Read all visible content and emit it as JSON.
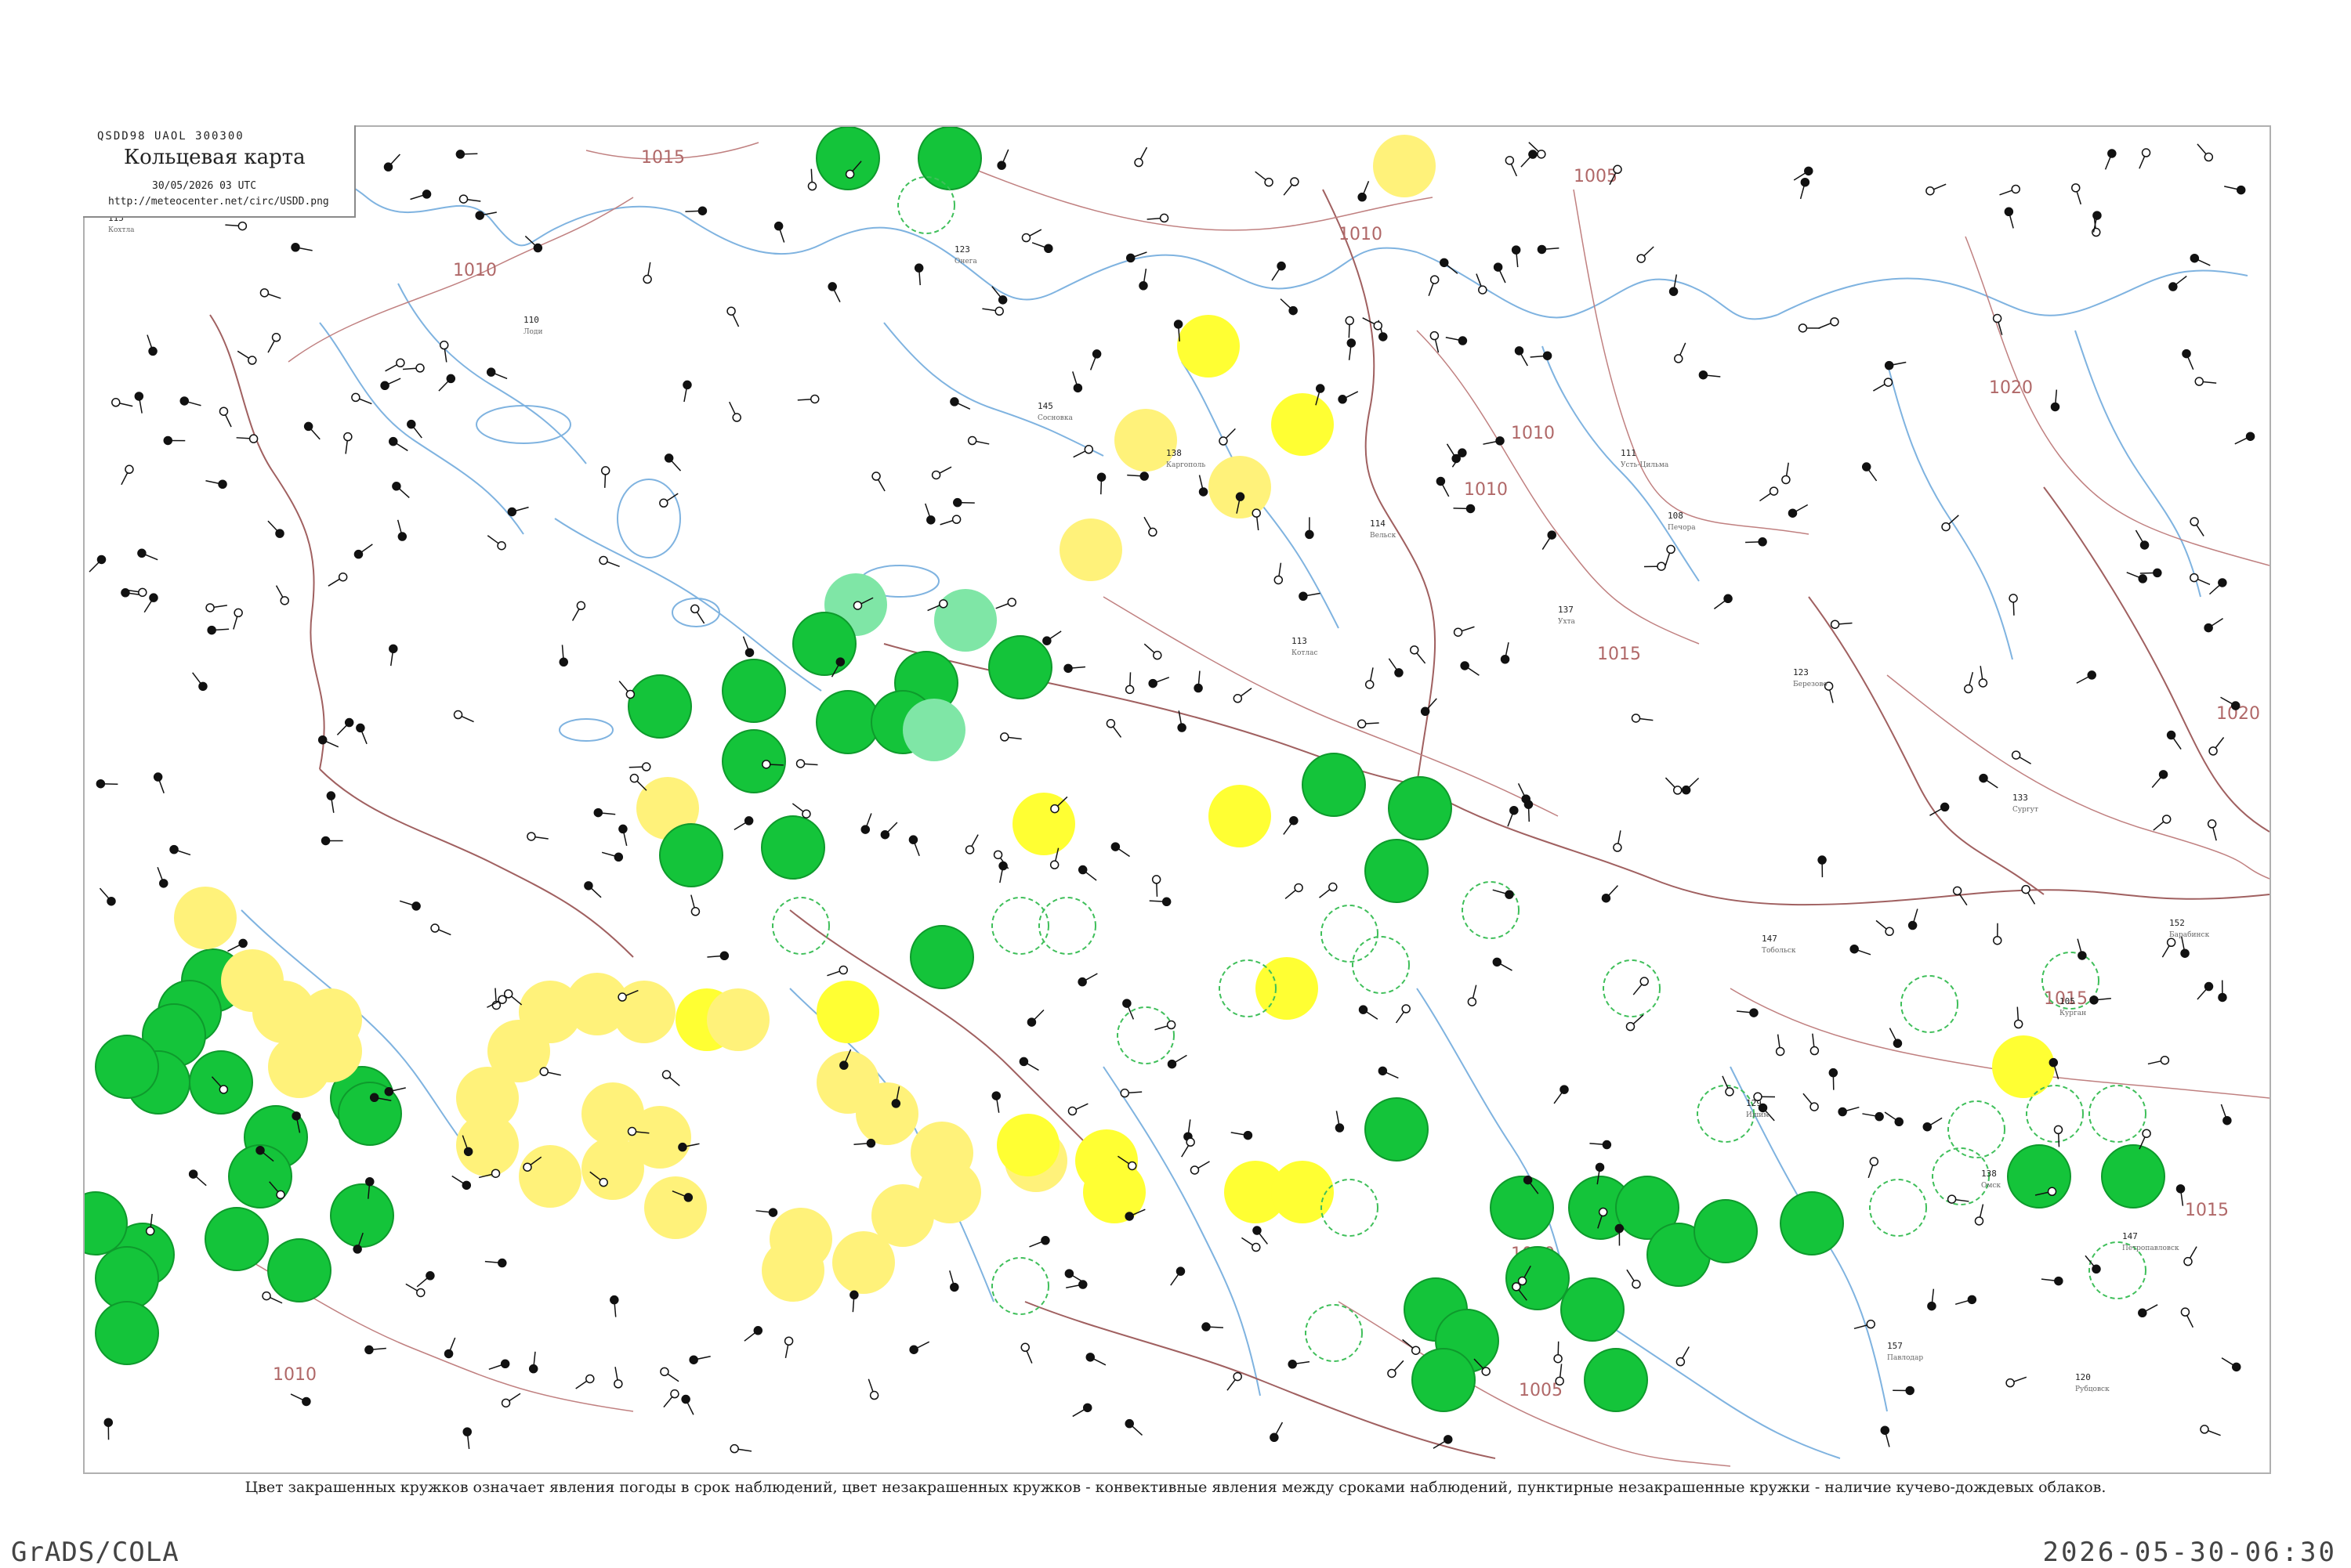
{
  "header": {
    "codes": "QSDD98  UAOL  300300",
    "title": "Кольцевая карта",
    "datetime": "30/05/2026 03 UTC",
    "url": "http://meteocenter.net/circ/USDD.png"
  },
  "isobar_labels": [
    {
      "name": "isobar-1015-top",
      "text": "1015"
    },
    {
      "name": "isobar-1010-west",
      "text": "1010"
    },
    {
      "name": "isobar-1010-north",
      "text": "1010"
    },
    {
      "name": "isobar-1005-north",
      "text": "1005"
    },
    {
      "name": "isobar-1010-ural",
      "text": "1010"
    },
    {
      "name": "isobar-1010-mid",
      "text": "1010"
    },
    {
      "name": "isobar-1015-siberia",
      "text": "1015"
    },
    {
      "name": "isobar-1020-ne",
      "text": "1020"
    },
    {
      "name": "isobar-1020-east",
      "text": "1020"
    },
    {
      "name": "isobar-1015-east",
      "text": "1015"
    },
    {
      "name": "isobar-1015-se",
      "text": "1015"
    },
    {
      "name": "isobar-1010-south",
      "text": "1010"
    },
    {
      "name": "isobar-1010-sw",
      "text": "1010"
    },
    {
      "name": "isobar-1005-south",
      "text": "1005"
    }
  ],
  "legend_colors": {
    "thunder": "#14c43a",
    "rain": "#fff27a",
    "heavy": "#ffff33",
    "shower": "#7fe6a6",
    "snow": "#6aa8f0",
    "dashed": "#3fbf5a"
  },
  "stations": [
    {
      "num": "115",
      "name": "Кохтла"
    },
    {
      "num": "110",
      "name": "Лоди"
    },
    {
      "num": "123",
      "name": "Онега"
    },
    {
      "num": "145",
      "name": "Сосновка"
    },
    {
      "num": "138",
      "name": "Каргополь"
    },
    {
      "num": "114",
      "name": "Вельск"
    },
    {
      "num": "113",
      "name": "Котлас"
    },
    {
      "num": "111",
      "name": "Усть-Цильма"
    },
    {
      "num": "137",
      "name": "Ухта"
    },
    {
      "num": "108",
      "name": "Печора"
    },
    {
      "num": "123",
      "name": "Березово"
    },
    {
      "num": "133",
      "name": "Сургут"
    },
    {
      "num": "147",
      "name": "Тобольск"
    },
    {
      "num": "129",
      "name": "Ишим"
    },
    {
      "num": "138",
      "name": "Омск"
    },
    {
      "num": "105",
      "name": "Курган"
    },
    {
      "num": "147",
      "name": "Петропавловск"
    },
    {
      "num": "152",
      "name": "Барабинск"
    },
    {
      "num": "120",
      "name": "Рубцовск"
    },
    {
      "num": "157",
      "name": "Павлодар"
    }
  ],
  "caption": "Цвет закрашенных кружков означает явления погоды в срок наблюдений, цвет незакрашенных кружков - конвективные явления между сроками наблюдений, пунктирные незакрашенные кружки - наличие кучево-дождевых облаков.",
  "footer": {
    "left": "GrADS/COLA",
    "right": "2026-05-30-06:30"
  }
}
